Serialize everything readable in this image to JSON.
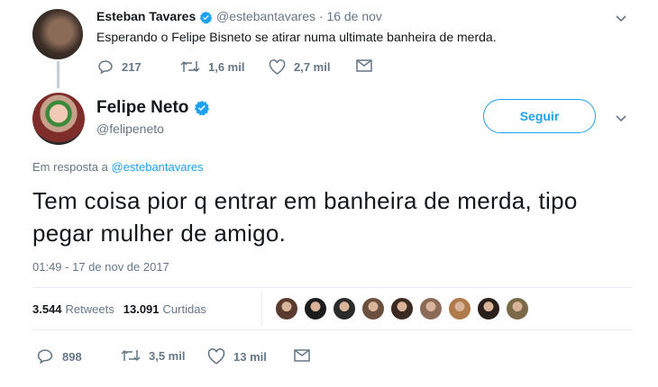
{
  "reply_tweet": {
    "name": "Esteban Tavares",
    "handle": "@estebantavares",
    "separator": "·",
    "date": "16 de nov",
    "text": "Esperando o Felipe Bisneto se atirar numa ultimate banheira de merda.",
    "replies": "217",
    "retweets": "1,6 mil",
    "likes": "2,7 mil"
  },
  "main_tweet": {
    "name": "Felipe Neto",
    "handle": "@felipeneto",
    "follow_label": "Seguir",
    "reply_prefix": "Em resposta a",
    "reply_handle": "@estebantavares",
    "text": "Tem coisa pior q entrar em banheira de merda, tipo pegar mulher de amigo.",
    "timestamp": "01:49 - 17 de nov de 2017",
    "retweets_count": "3.544",
    "retweets_label": "Retweets",
    "likes_count": "13.091",
    "likes_label": "Curtidas",
    "liker_colors": [
      "#5a3a2e",
      "#1c1c1c",
      "#2b2b2b",
      "#6b4f3f",
      "#3a2a22",
      "#8c6a58",
      "#b07a4a",
      "#2a1f1a",
      "#7a6a4a"
    ],
    "replies": "898",
    "retweets": "3,5 mil",
    "likes": "13 mil"
  },
  "colors": {
    "accent": "#1da1f2",
    "muted": "#657786",
    "text": "#14171a"
  }
}
